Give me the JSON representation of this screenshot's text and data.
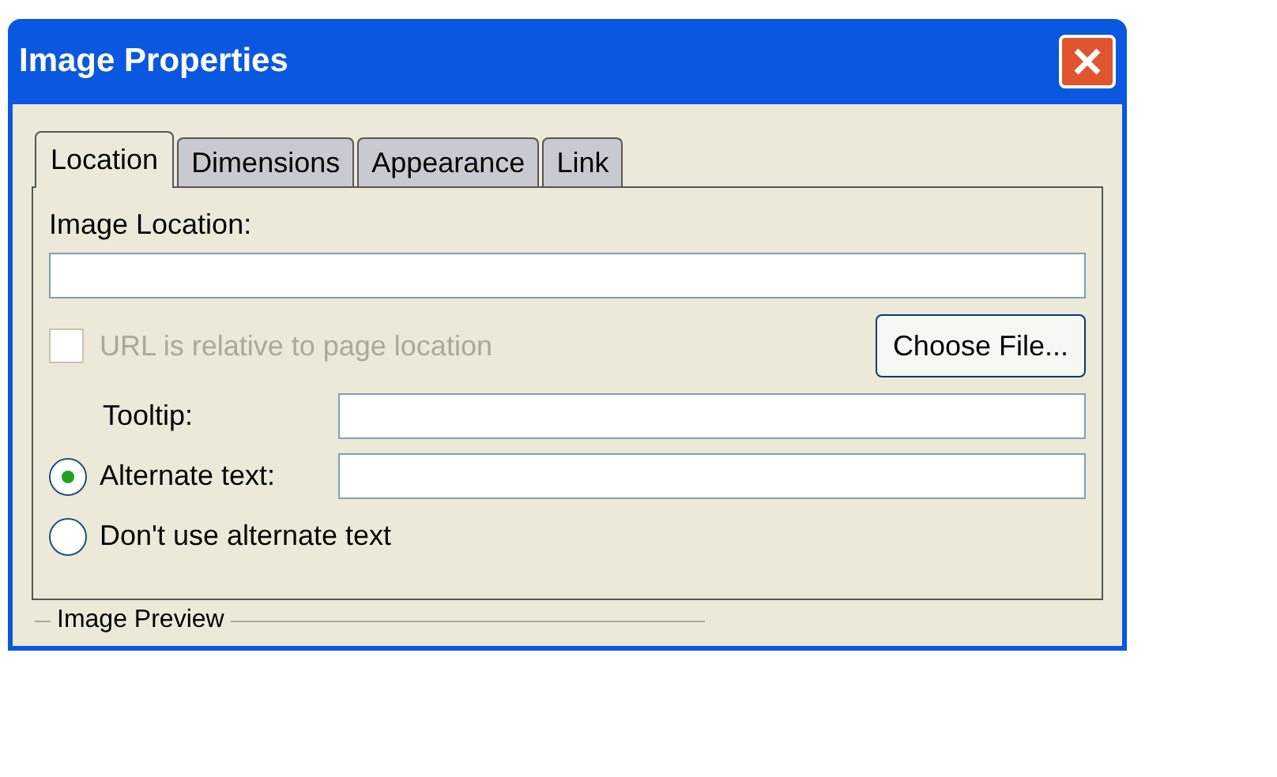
{
  "window": {
    "title": "Image Properties"
  },
  "tabs": [
    {
      "label": "Location",
      "selected": true
    },
    {
      "label": "Dimensions",
      "selected": false
    },
    {
      "label": "Appearance",
      "selected": false
    },
    {
      "label": "Link",
      "selected": false
    }
  ],
  "image_location": {
    "label": "Image Location:"
  },
  "relative_url": {
    "label": "URL is relative to page location",
    "checked": false,
    "disabled": true
  },
  "choose_file_button": "Choose File...",
  "tooltip": {
    "label": "Tooltip:"
  },
  "alt_options": [
    {
      "label": "Alternate text:",
      "selected": true,
      "has_field": true
    },
    {
      "label": "Don't use alternate text",
      "selected": false,
      "has_field": false
    }
  ],
  "preview_group": {
    "label": "Image Preview"
  }
}
